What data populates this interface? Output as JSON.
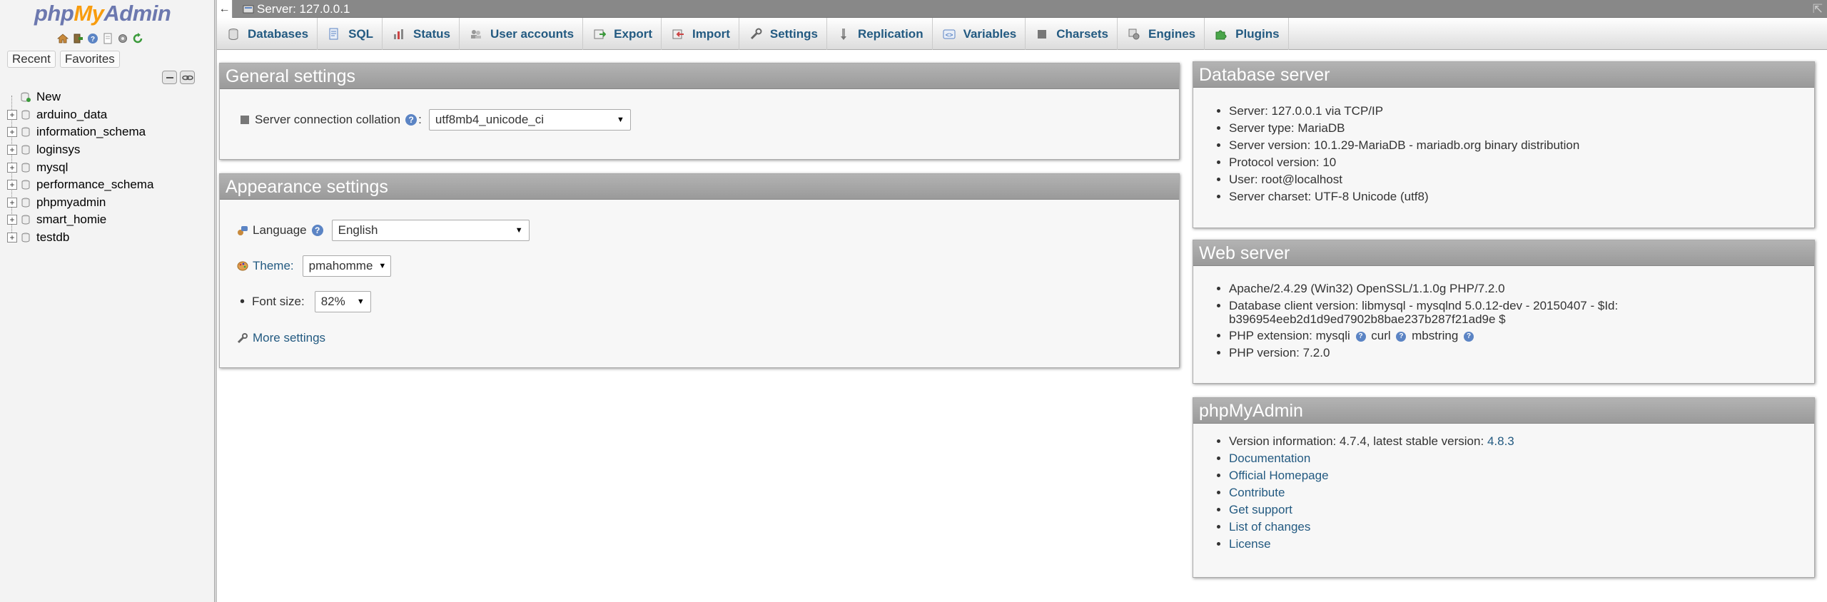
{
  "logo": {
    "php": "php",
    "my": "My",
    "admin": "Admin"
  },
  "nav": {
    "tabs": [
      "Recent",
      "Favorites"
    ],
    "databases": [
      {
        "name": "New",
        "type": "new"
      },
      {
        "name": "arduino_data",
        "type": "db"
      },
      {
        "name": "information_schema",
        "type": "db"
      },
      {
        "name": "loginsys",
        "type": "db"
      },
      {
        "name": "mysql",
        "type": "db"
      },
      {
        "name": "performance_schema",
        "type": "db"
      },
      {
        "name": "phpmyadmin",
        "type": "db"
      },
      {
        "name": "smart_homie",
        "type": "db"
      },
      {
        "name": "testdb",
        "type": "db"
      }
    ]
  },
  "topbar": {
    "back": "←",
    "server": "Server: 127.0.0.1",
    "close": "⇱"
  },
  "menu": [
    {
      "label": "Databases",
      "icon": "database-icon"
    },
    {
      "label": "SQL",
      "icon": "sql-icon"
    },
    {
      "label": "Status",
      "icon": "status-icon"
    },
    {
      "label": "User accounts",
      "icon": "users-icon"
    },
    {
      "label": "Export",
      "icon": "export-icon"
    },
    {
      "label": "Import",
      "icon": "import-icon"
    },
    {
      "label": "Settings",
      "icon": "wrench-icon"
    },
    {
      "label": "Replication",
      "icon": "replication-icon"
    },
    {
      "label": "Variables",
      "icon": "variables-icon"
    },
    {
      "label": "Charsets",
      "icon": "charsets-icon"
    },
    {
      "label": "Engines",
      "icon": "engines-icon"
    },
    {
      "label": "Plugins",
      "icon": "puzzle-icon"
    }
  ],
  "general": {
    "title": "General settings",
    "collation_label": "Server connection collation",
    "collation_colon": ":",
    "collation_value": "utf8mb4_unicode_ci"
  },
  "appearance": {
    "title": "Appearance settings",
    "language_label": "Language",
    "language_value": "English",
    "theme_label": "Theme:",
    "theme_value": "pmahomme",
    "fontsize_label": "Font size:",
    "fontsize_value": "82%",
    "more_settings": "More settings"
  },
  "dbserver": {
    "title": "Database server",
    "items": [
      "Server: 127.0.0.1 via TCP/IP",
      "Server type: MariaDB",
      "Server version: 10.1.29-MariaDB - mariadb.org binary distribution",
      "Protocol version: 10",
      "User: root@localhost",
      "Server charset: UTF-8 Unicode (utf8)"
    ]
  },
  "webserver": {
    "title": "Web server",
    "apache": "Apache/2.4.29 (Win32) OpenSSL/1.1.0g PHP/7.2.0",
    "client_line1": "Database client version: libmysql - mysqlnd 5.0.12-dev - 20150407 - $Id:",
    "client_line2": "b396954eeb2d1d9ed7902b8bae237b287f21ad9e $",
    "php_ext_label": "PHP extension: mysqli",
    "php_ext_curl": "curl",
    "php_ext_mbstring": "mbstring",
    "php_version": "PHP version: 7.2.0"
  },
  "pma": {
    "title": "phpMyAdmin",
    "version_text": "Version information: 4.7.4, latest stable version:",
    "latest_version": "4.8.3",
    "links": [
      "Documentation",
      "Official Homepage",
      "Contribute",
      "Get support",
      "List of changes",
      "License"
    ]
  },
  "colors": {
    "link": "#235a81",
    "header_bg": "#9a9a9a",
    "logo_orange": "#f89c0e",
    "logo_blue": "#6c78af"
  }
}
